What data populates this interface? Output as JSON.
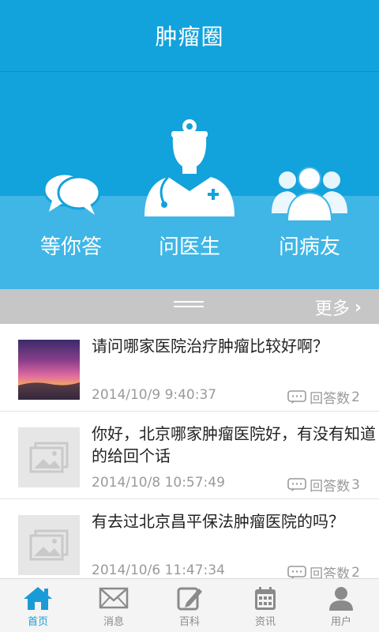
{
  "header": {
    "title": "肿瘤圈"
  },
  "features": [
    {
      "label": "等你答",
      "icon": "chat-bubbles-icon"
    },
    {
      "label": "问医生",
      "icon": "doctor-icon"
    },
    {
      "label": "问病友",
      "icon": "group-icon"
    }
  ],
  "morebar": {
    "more_label": "更多",
    "chevron": "›"
  },
  "questions": [
    {
      "title": "请问哪家医院治疗肿瘤比较好啊？",
      "time": "2014/10/9 9:40:37",
      "answers_label": "回答数",
      "answers": "2",
      "thumb": "sunset-photo"
    },
    {
      "title": "你好，北京哪家肿瘤医院好，有没有知道的给回个话",
      "time": "2014/10/8 10:57:49",
      "answers_label": "回答数",
      "answers": "3",
      "thumb": "image-placeholder-icon"
    },
    {
      "title": "有去过北京昌平保法肿瘤医院的吗？",
      "time": "2014/10/6 11:47:34",
      "answers_label": "回答数",
      "answers": "2",
      "thumb": "image-placeholder-icon"
    }
  ],
  "tabs": [
    {
      "label": "首页",
      "icon": "home-icon",
      "active": true
    },
    {
      "label": "消息",
      "icon": "mail-icon",
      "active": false
    },
    {
      "label": "百科",
      "icon": "edit-icon",
      "active": false
    },
    {
      "label": "资讯",
      "icon": "calendar-icon",
      "active": false
    },
    {
      "label": "用户",
      "icon": "user-icon",
      "active": false
    }
  ],
  "colors": {
    "primary": "#12a2dc",
    "hero_bottom": "#3fb6e6",
    "active_tab": "#1a9bd7",
    "morebar": "#c6c6c6"
  }
}
